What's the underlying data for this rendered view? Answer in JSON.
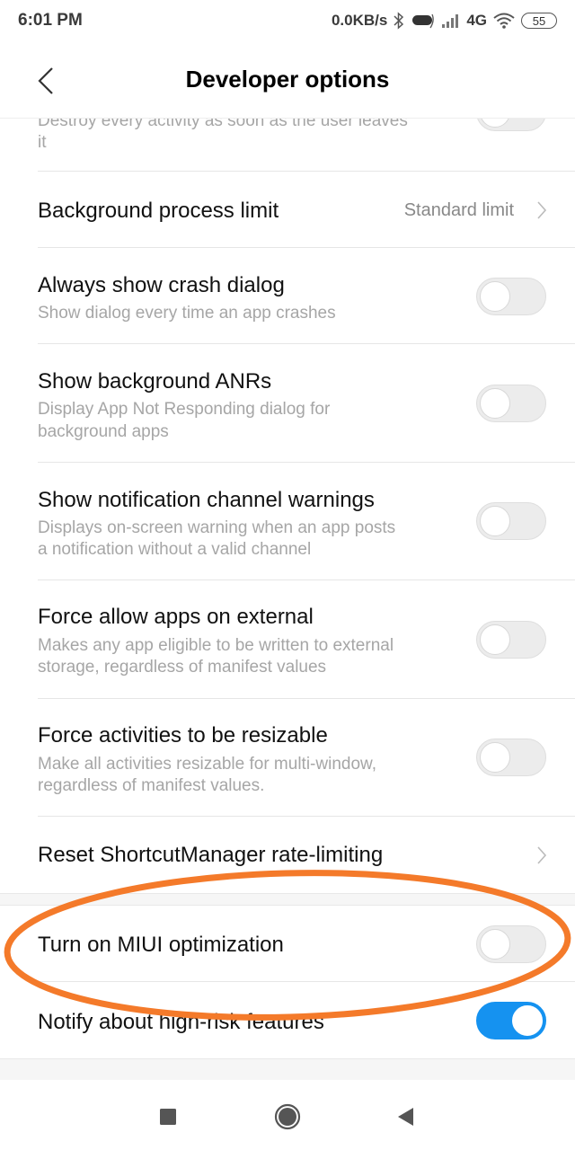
{
  "status_bar": {
    "time": "6:01 PM",
    "network_speed": "0.0KB/s",
    "network_type": "4G",
    "battery_level": "55",
    "icons": [
      "bluetooth-icon",
      "hotspot-icon",
      "signal-icon",
      "wifi-icon",
      "battery-icon"
    ]
  },
  "header": {
    "title": "Developer options",
    "back_icon": "chevron-left-icon"
  },
  "settings": {
    "partial_item": {
      "subtitle_line1": "Destroy every activity as soon as the user leaves",
      "subtitle_line2": "it",
      "enabled": false
    },
    "background_process_limit": {
      "title": "Background process limit",
      "value": "Standard limit"
    },
    "always_show_crash_dialog": {
      "title": "Always show crash dialog",
      "subtitle": "Show dialog every time an app crashes",
      "enabled": false
    },
    "show_background_anrs": {
      "title": "Show background ANRs",
      "subtitle_line1": "Display App Not Responding dialog for",
      "subtitle_line2": "background apps",
      "enabled": false
    },
    "show_notification_channel_warnings": {
      "title": "Show notification channel warnings",
      "subtitle_line1": "Displays on-screen warning when an app posts",
      "subtitle_line2": "a notification without a valid channel",
      "enabled": false
    },
    "force_allow_apps_external": {
      "title": "Force allow apps on external",
      "subtitle_line1": "Makes any app eligible to be written to external",
      "subtitle_line2": "storage, regardless of manifest values",
      "enabled": false
    },
    "force_activities_resizable": {
      "title": "Force activities to be resizable",
      "subtitle_line1": "Make all activities resizable for multi-window,",
      "subtitle_line2": "regardless of manifest values.",
      "enabled": false
    },
    "reset_shortcut_manager": {
      "title": "Reset ShortcutManager rate-limiting"
    },
    "miui_optimization": {
      "title": "Turn on MIUI optimization",
      "enabled": false
    },
    "notify_high_risk": {
      "title": "Notify about high-risk features",
      "enabled": true
    }
  },
  "annotation": {
    "shape": "ellipse",
    "color": "#f47a2a",
    "highlights": "Turn on MIUI optimization"
  },
  "nav_bar": {
    "icons": [
      "recents-icon",
      "home-icon",
      "back-icon"
    ]
  },
  "colors": {
    "toggle_on": "#1592f0",
    "toggle_off": "#ececec",
    "annotation": "#f47a2a"
  }
}
